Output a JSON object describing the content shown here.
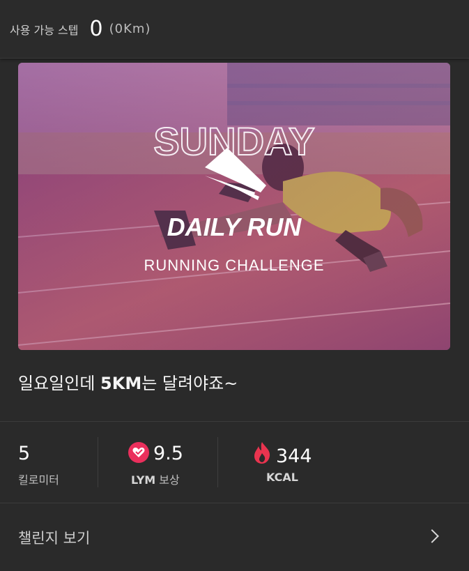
{
  "header": {
    "available_steps_label": "사용 가능 스텝",
    "steps_value": "0",
    "distance_value": "(0Km)"
  },
  "banner": {
    "day_text": "SUNDAY",
    "title_text": "DAILY RUN",
    "subtitle_text": "RUNNING CHALLENGE",
    "tint_top": "#b07aa8",
    "tint_bottom": "#6e2f7e",
    "track_color": "#b0606a"
  },
  "challenge": {
    "title_prefix": "일요일인데 ",
    "title_bold": "5KM",
    "title_suffix": "는 달려야죠~"
  },
  "stats": {
    "distance": {
      "value": "5",
      "caption": "킬로미터"
    },
    "reward": {
      "value": "9.5",
      "caption_bold": "LYM",
      "caption_rest": " 보상",
      "icon": "heart-badge-icon",
      "color": "#ea2f5c"
    },
    "calories": {
      "value": "344",
      "caption": "KCAL",
      "icon": "flame-icon",
      "color": "#e9344f"
    }
  },
  "footer": {
    "view_challenge_label": "챌린지 보기",
    "icon": "chevron-right-icon"
  }
}
